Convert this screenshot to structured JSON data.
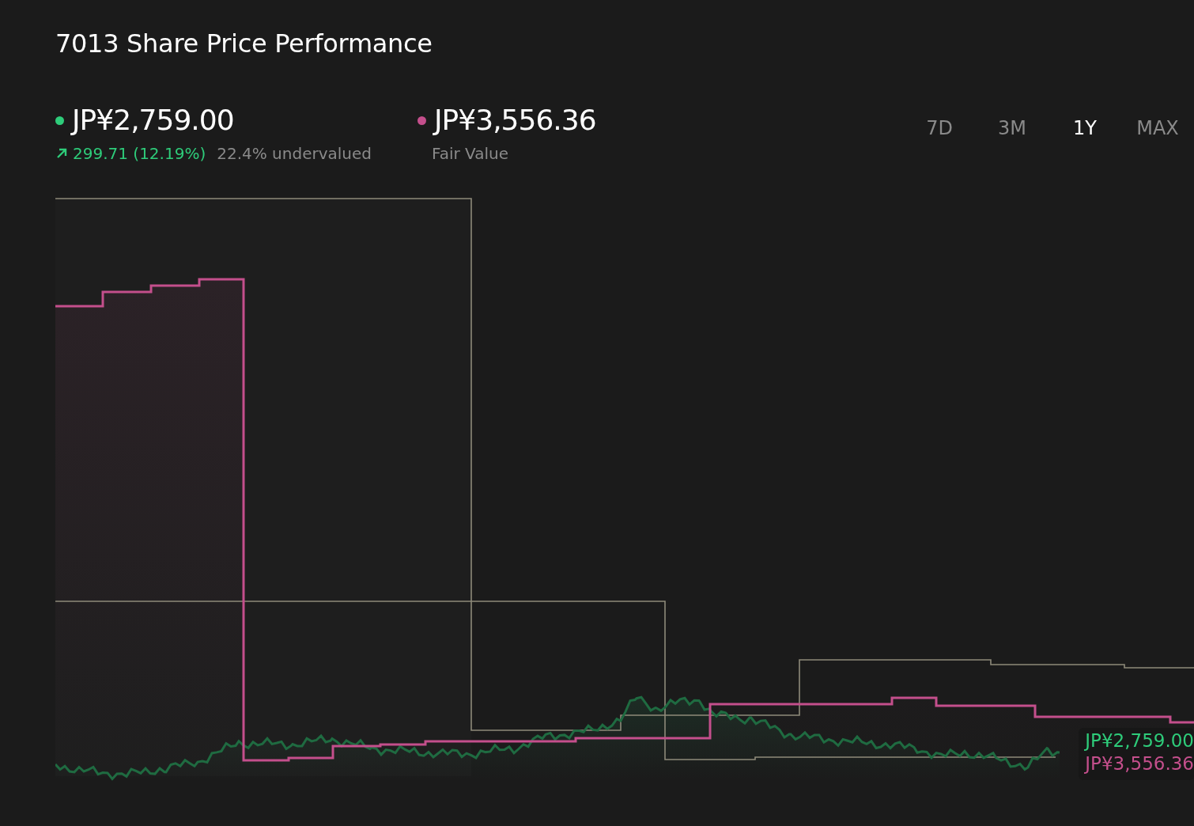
{
  "title": "7013 Share Price Performance",
  "legend": [
    {
      "kind": "price",
      "value": "JP¥2,759.00",
      "color": "#2ecc7a",
      "change": "299.71 (12.19%)",
      "note": "22.4% undervalued"
    },
    {
      "kind": "fair",
      "value": "JP¥3,556.36",
      "color": "#c44f8c",
      "note": "Fair Value"
    }
  ],
  "tabs": [
    {
      "label": "7D",
      "selected": false
    },
    {
      "label": "3M",
      "selected": false
    },
    {
      "label": "1Y",
      "selected": true
    },
    {
      "label": "MAX",
      "selected": false
    }
  ],
  "end_labels": [
    {
      "text": "JP¥2,759.00",
      "color": "#2ecc7a"
    },
    {
      "text": "JP¥3,556.36",
      "color": "#c44f8c"
    }
  ]
}
